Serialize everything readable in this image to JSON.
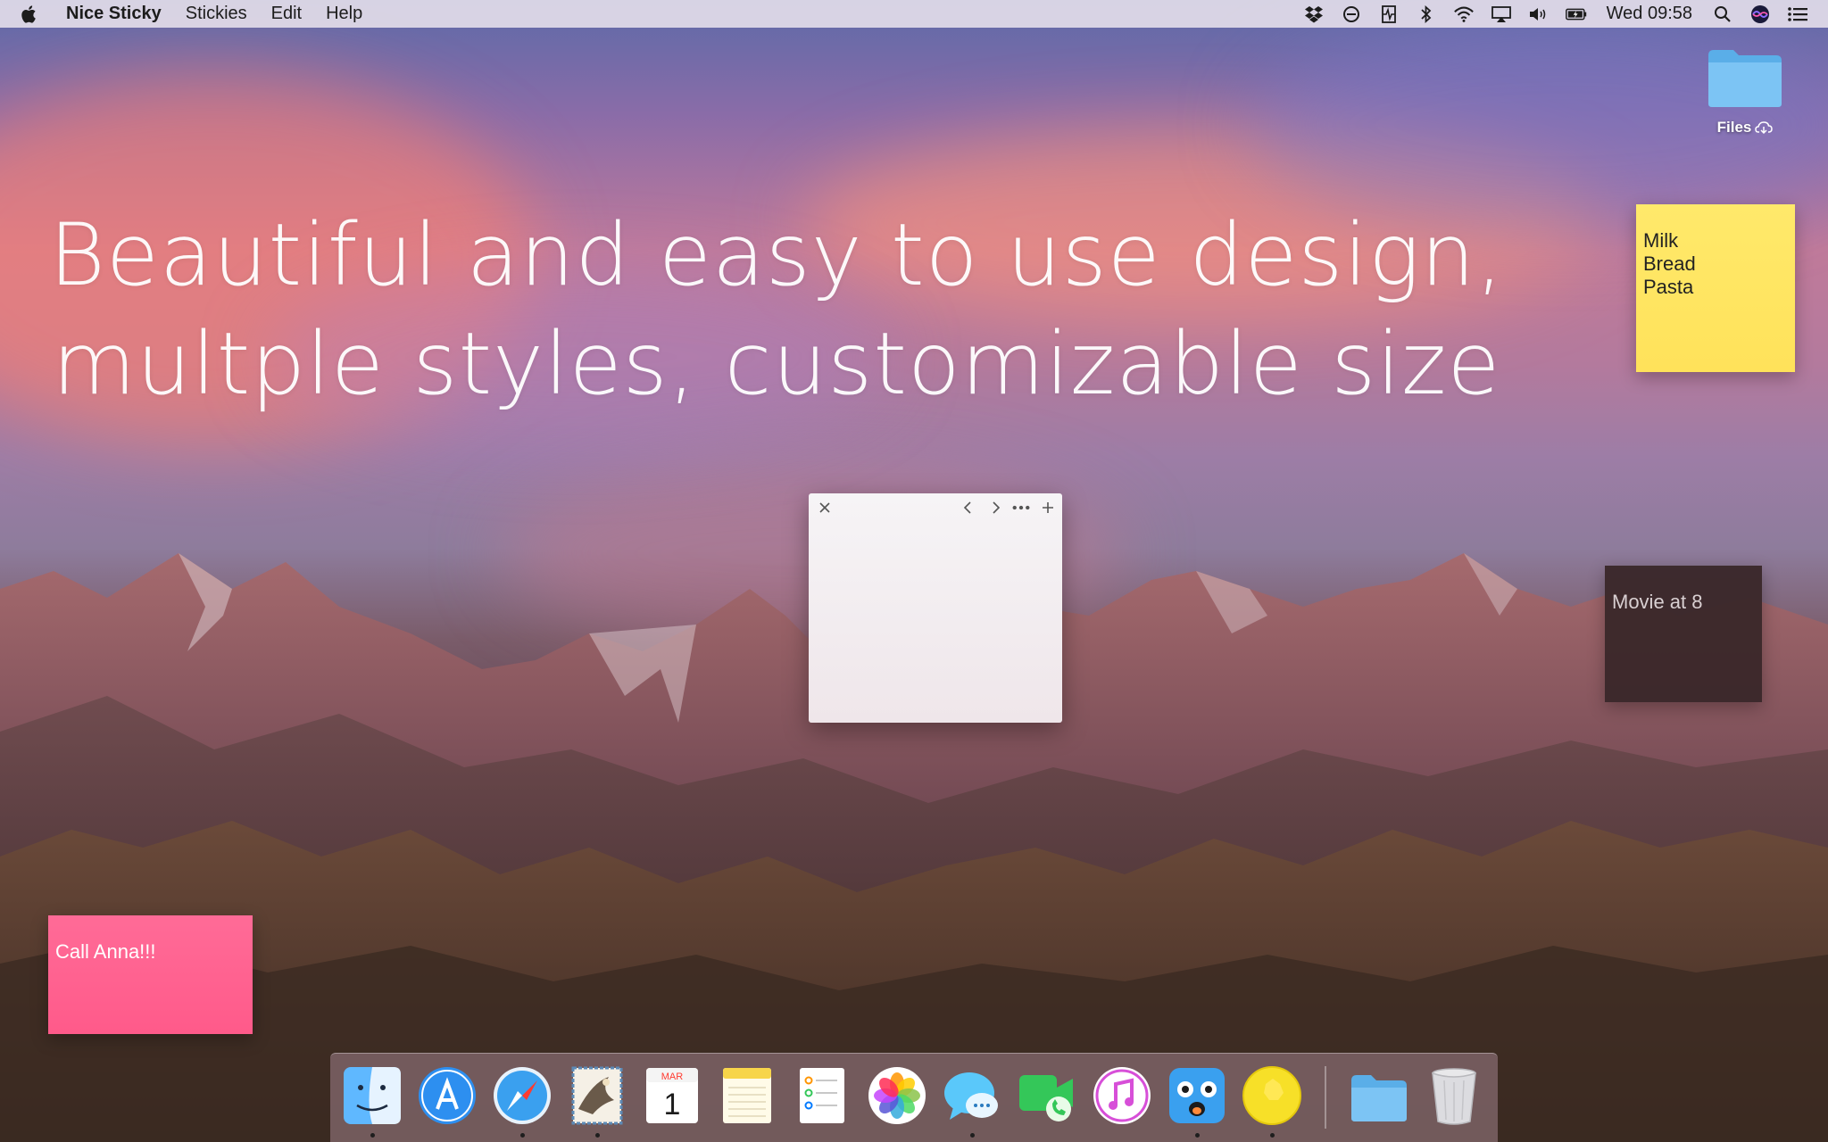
{
  "menubar": {
    "app_name": "Nice Sticky",
    "items": [
      "Stickies",
      "Edit",
      "Help"
    ],
    "clock": "Wed 09:58"
  },
  "hero": {
    "line1": "Beautiful and easy to use design,",
    "line2": "multple styles, customizable size"
  },
  "desktop": {
    "files_label": "Files"
  },
  "stickies": {
    "yellow_text": "Milk\nBread\nPasta",
    "dark_text": "Movie at 8",
    "pink_text": "Call Anna!!!",
    "yellow_color": "#ffe25a",
    "dark_color": "#3a282a",
    "pink_color": "#ff5a8a"
  },
  "note_window": {
    "toolbar": [
      "close-icon",
      "chevron-left-icon",
      "chevron-right-icon",
      "more-icon",
      "plus-icon"
    ]
  },
  "dock": {
    "items": [
      {
        "name": "finder-icon",
        "running": true
      },
      {
        "name": "app-store-icon",
        "running": false
      },
      {
        "name": "safari-icon",
        "running": true
      },
      {
        "name": "mail-icon",
        "running": true
      },
      {
        "name": "calendar-icon",
        "month": "MAR",
        "day": "1",
        "running": false
      },
      {
        "name": "notes-icon",
        "running": false
      },
      {
        "name": "reminders-icon",
        "running": false
      },
      {
        "name": "photos-icon",
        "running": false
      },
      {
        "name": "messages-icon",
        "running": true
      },
      {
        "name": "facetime-icon",
        "running": false
      },
      {
        "name": "itunes-icon",
        "running": false
      },
      {
        "name": "tweetbot-icon",
        "running": true
      },
      {
        "name": "nice-sticky-icon",
        "running": true
      },
      {
        "name": "downloads-folder-icon",
        "running": false
      },
      {
        "name": "trash-icon",
        "running": false
      }
    ]
  }
}
